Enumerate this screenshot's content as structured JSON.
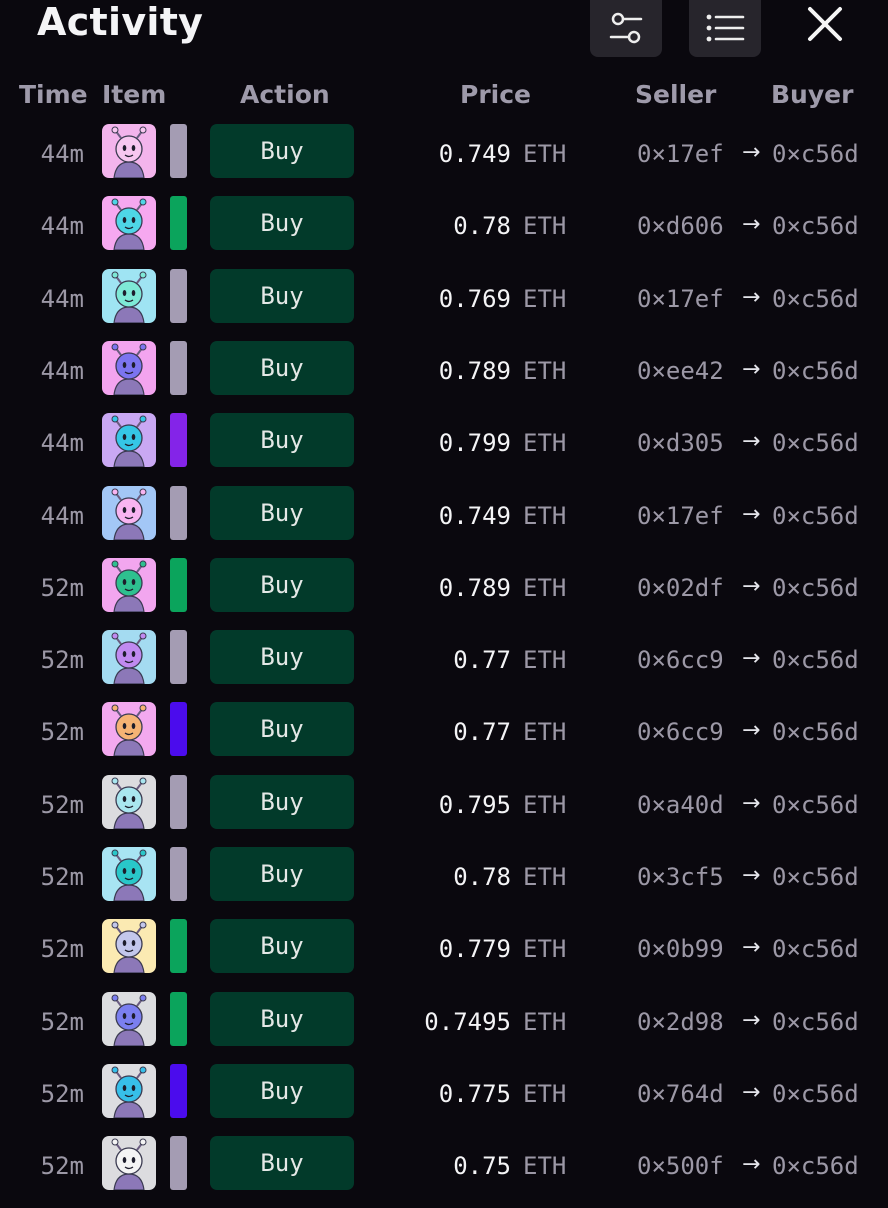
{
  "header": {
    "title": "Activity",
    "filter_icon": "sliders-icon",
    "list_icon": "list-icon",
    "close_icon": "close-icon"
  },
  "columns": {
    "time": "Time",
    "item": "Item",
    "action": "Action",
    "price": "Price",
    "seller": "Seller",
    "buyer": "Buyer"
  },
  "colors": {
    "background": "#0a080e",
    "button_bg": "#023a2a",
    "rarity_gray": "#a49cb3",
    "rarity_green": "#0ba45c",
    "rarity_purple": "#8424e8",
    "rarity_indigo": "#4b0ced"
  },
  "rows": [
    {
      "time": "44m",
      "action": "Buy",
      "price": "0.749",
      "unit": "ETH",
      "seller": "0×17ef",
      "arrow": "→",
      "buyer": "0×c56d",
      "rarity": "gray",
      "thumb": "#f3b4ec",
      "char": "#f7c7f0"
    },
    {
      "time": "44m",
      "action": "Buy",
      "price": "0.78",
      "unit": "ETH",
      "seller": "0×d606",
      "arrow": "→",
      "buyer": "0×c56d",
      "rarity": "green",
      "thumb": "#f6a8f0",
      "char": "#4ed6e6"
    },
    {
      "time": "44m",
      "action": "Buy",
      "price": "0.769",
      "unit": "ETH",
      "seller": "0×17ef",
      "arrow": "→",
      "buyer": "0×c56d",
      "rarity": "gray",
      "thumb": "#9fe4f3",
      "char": "#7ee9d6"
    },
    {
      "time": "44m",
      "action": "Buy",
      "price": "0.789",
      "unit": "ETH",
      "seller": "0×ee42",
      "arrow": "→",
      "buyer": "0×c56d",
      "rarity": "gray",
      "thumb": "#f3a4ef",
      "char": "#7c74f0"
    },
    {
      "time": "44m",
      "action": "Buy",
      "price": "0.799",
      "unit": "ETH",
      "seller": "0×d305",
      "arrow": "→",
      "buyer": "0×c56d",
      "rarity": "purple",
      "thumb": "#c9a8f3",
      "char": "#35c6e6"
    },
    {
      "time": "44m",
      "action": "Buy",
      "price": "0.749",
      "unit": "ETH",
      "seller": "0×17ef",
      "arrow": "→",
      "buyer": "0×c56d",
      "rarity": "gray",
      "thumb": "#a3c7f6",
      "char": "#f8b4f0"
    },
    {
      "time": "52m",
      "action": "Buy",
      "price": "0.789",
      "unit": "ETH",
      "seller": "0×02df",
      "arrow": "→",
      "buyer": "0×c56d",
      "rarity": "green",
      "thumb": "#f2a6ef",
      "char": "#2ec08f"
    },
    {
      "time": "52m",
      "action": "Buy",
      "price": "0.77",
      "unit": "ETH",
      "seller": "0×6cc9",
      "arrow": "→",
      "buyer": "0×c56d",
      "rarity": "gray",
      "thumb": "#a4dbf1",
      "char": "#c08af0"
    },
    {
      "time": "52m",
      "action": "Buy",
      "price": "0.77",
      "unit": "ETH",
      "seller": "0×6cc9",
      "arrow": "→",
      "buyer": "0×c56d",
      "rarity": "indigo",
      "thumb": "#f3a9ef",
      "char": "#f6b374"
    },
    {
      "time": "52m",
      "action": "Buy",
      "price": "0.795",
      "unit": "ETH",
      "seller": "0×a40d",
      "arrow": "→",
      "buyer": "0×c56d",
      "rarity": "gray",
      "thumb": "#dcdcdf",
      "char": "#a9e6ef"
    },
    {
      "time": "52m",
      "action": "Buy",
      "price": "0.78",
      "unit": "ETH",
      "seller": "0×3cf5",
      "arrow": "→",
      "buyer": "0×c56d",
      "rarity": "gray",
      "thumb": "#a8e4f3",
      "char": "#29c7c9"
    },
    {
      "time": "52m",
      "action": "Buy",
      "price": "0.779",
      "unit": "ETH",
      "seller": "0×0b99",
      "arrow": "→",
      "buyer": "0×c56d",
      "rarity": "green",
      "thumb": "#fbeab2",
      "char": "#c3c7ec"
    },
    {
      "time": "52m",
      "action": "Buy",
      "price": "0.7495",
      "unit": "ETH",
      "seller": "0×2d98",
      "arrow": "→",
      "buyer": "0×c56d",
      "rarity": "green",
      "thumb": "#dcdde0",
      "char": "#7b7ff0"
    },
    {
      "time": "52m",
      "action": "Buy",
      "price": "0.775",
      "unit": "ETH",
      "seller": "0×764d",
      "arrow": "→",
      "buyer": "0×c56d",
      "rarity": "indigo",
      "thumb": "#dddde1",
      "char": "#37bfe9"
    },
    {
      "time": "52m",
      "action": "Buy",
      "price": "0.75",
      "unit": "ETH",
      "seller": "0×500f",
      "arrow": "→",
      "buyer": "0×c56d",
      "rarity": "gray",
      "thumb": "#dcdcdf",
      "char": "#f4f4f4"
    }
  ]
}
